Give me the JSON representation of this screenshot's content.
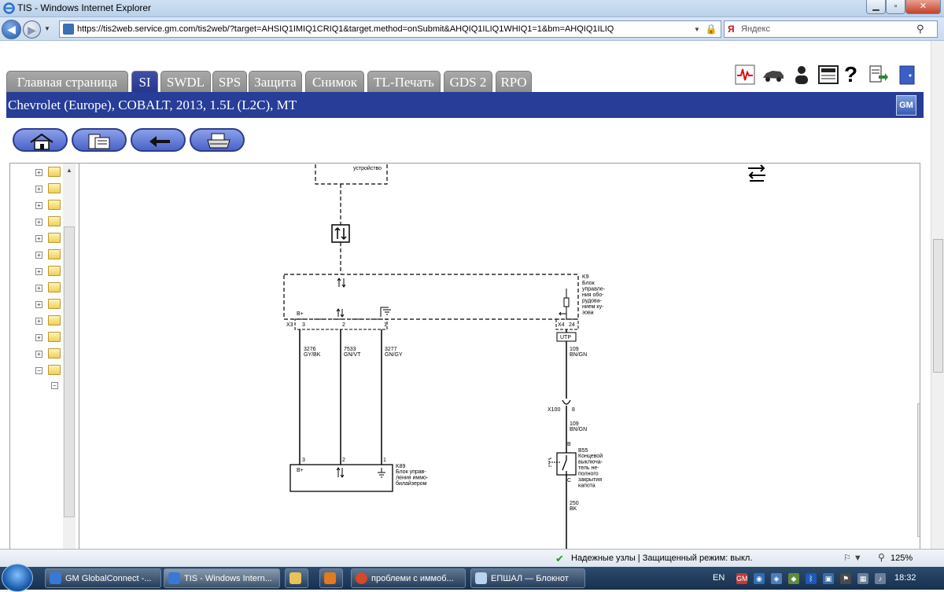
{
  "window": {
    "title": "TIS - Windows Internet Explorer"
  },
  "browser": {
    "url_host": "https://tis2web.service.",
    "url_domain": "gm.com",
    "url_rest": "/tis2web/?target=AHSIQ1IMIQ1CRIQ1&target.method=onSubmit&AHQIQ1ILIQ1WHIQ1=1&bm=AHQIQ1ILIQ",
    "search_placeholder": "Яндекс"
  },
  "tabs": [
    {
      "label": "Главная страница",
      "active": false
    },
    {
      "label": "SI",
      "active": true
    },
    {
      "label": "SWDL",
      "active": false
    },
    {
      "label": "SPS",
      "active": false
    },
    {
      "label": "Защита",
      "active": false
    },
    {
      "label": "Снимок",
      "active": false
    },
    {
      "label": "TL-Печать",
      "active": false
    },
    {
      "label": "GDS 2",
      "active": false
    },
    {
      "label": "RPO",
      "active": false
    }
  ],
  "vehicle": {
    "description": "Chevrolet (Europe), COBALT, 2013, 1.5L (L2C), MT",
    "logo": "GM"
  },
  "diagram": {
    "device_top": "устройство",
    "k9_label": "K9",
    "k9_desc": [
      "Блок",
      "управле-",
      "ния обо-",
      "рудова-",
      "нием ку-",
      "зова"
    ],
    "x3": "X3",
    "x4": "X4",
    "pin_24": "24",
    "b_plus": "B+",
    "pins_top": [
      "3",
      "2",
      "1"
    ],
    "wire_3276": "3276",
    "wire_3276_color": "GY/BK",
    "wire_7533": "7533",
    "wire_7533_color": "GN/VT",
    "wire_3277": "3277",
    "wire_3277_color": "GN/GY",
    "utp": "UTP",
    "wire_109": "109",
    "wire_109_color": "BN/GN",
    "x100": "X100",
    "pin_8": "8",
    "wire_109b": "109",
    "wire_109b_color": "BN/GN",
    "b55_pin_b": "B",
    "b55_label": "B55",
    "b55_desc": [
      "Концевой",
      "выключа-",
      "тель не-",
      "полного",
      "закрытия",
      "капота"
    ],
    "b55_pin_c": "C",
    "wire_250": "250",
    "wire_250_color": "BK",
    "k89_label": "K89",
    "k89_desc": [
      "Блок управ-",
      "ления иммо-",
      "билайзером"
    ],
    "pins_bottom": [
      "3",
      "2",
      "1"
    ]
  },
  "status": {
    "zone_text": "Надежные узлы | Защищенный режим: выкл.",
    "zoom": "125%"
  },
  "taskbar": {
    "items": [
      {
        "label": "GM GlobalConnect -..."
      },
      {
        "label": "TIS - Windows Intern..."
      },
      {
        "label": "проблеми с иммоб..."
      },
      {
        "label": "ЕПШАЛ — Блокнот"
      }
    ],
    "lang": "EN",
    "time": "18:32"
  }
}
